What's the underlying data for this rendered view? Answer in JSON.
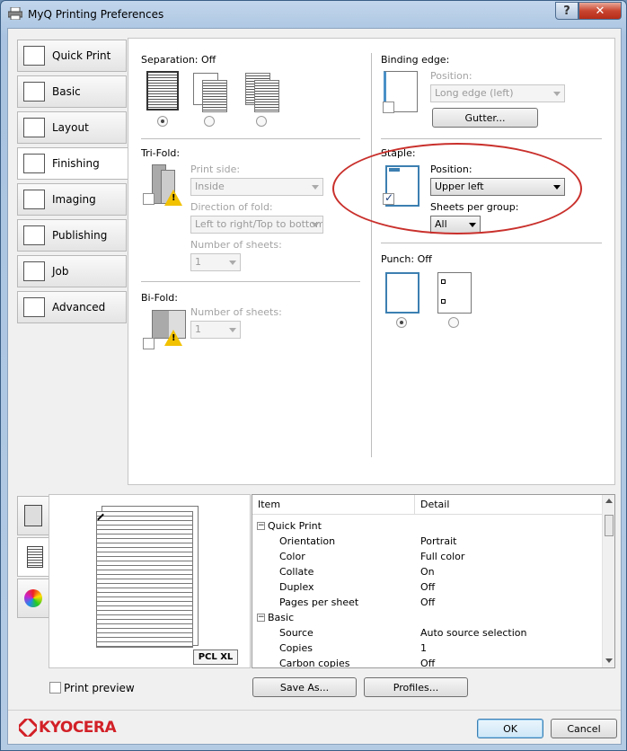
{
  "window": {
    "title": "MyQ Printing Preferences",
    "help_label": "?",
    "close_label": "✕"
  },
  "nav": [
    {
      "label": "Quick Print",
      "icon": "quick-print-icon"
    },
    {
      "label": "Basic",
      "icon": "basic-icon"
    },
    {
      "label": "Layout",
      "icon": "layout-icon"
    },
    {
      "label": "Finishing",
      "icon": "finishing-icon",
      "active": true
    },
    {
      "label": "Imaging",
      "icon": "imaging-icon"
    },
    {
      "label": "Publishing",
      "icon": "publishing-icon"
    },
    {
      "label": "Job",
      "icon": "job-icon"
    },
    {
      "label": "Advanced",
      "icon": "advanced-icon"
    }
  ],
  "separation": {
    "label": "Separation:",
    "value": "Off"
  },
  "trifold": {
    "label": "Tri-Fold:",
    "print_side_label": "Print side:",
    "print_side_value": "Inside",
    "direction_label": "Direction of fold:",
    "direction_value": "Left to right/Top to bottom",
    "sheets_label": "Number of sheets:",
    "sheets_value": "1"
  },
  "bifold": {
    "label": "Bi-Fold:",
    "sheets_label": "Number of sheets:",
    "sheets_value": "1"
  },
  "binding": {
    "label": "Binding edge:",
    "position_label": "Position:",
    "position_value": "Long edge (left)",
    "gutter_button": "Gutter..."
  },
  "staple": {
    "label": "Staple:",
    "position_label": "Position:",
    "position_value": "Upper left",
    "sheets_label": "Sheets per group:",
    "sheets_value": "All"
  },
  "punch": {
    "label": "Punch:",
    "value": "Off"
  },
  "preview": {
    "badge": "PCL XL",
    "print_preview_label": "Print preview"
  },
  "summary": {
    "headers": [
      "Item",
      "Detail"
    ],
    "groups": [
      {
        "name": "Quick Print",
        "rows": [
          [
            "Orientation",
            "Portrait"
          ],
          [
            "Color",
            "Full color"
          ],
          [
            "Collate",
            "On"
          ],
          [
            "Duplex",
            "Off"
          ],
          [
            "Pages per sheet",
            "Off"
          ]
        ]
      },
      {
        "name": "Basic",
        "rows": [
          [
            "Source",
            "Auto source selection"
          ],
          [
            "Copies",
            "1"
          ],
          [
            "Carbon copies",
            "Off"
          ]
        ]
      }
    ]
  },
  "buttons": {
    "save_as": "Save As...",
    "profiles": "Profiles...",
    "ok": "OK",
    "cancel": "Cancel"
  },
  "brand": {
    "name": "KYOCERA",
    "color": "#d22027"
  },
  "colors": {
    "annotation": "#c9302c",
    "selection_border": "#3c7fb1"
  }
}
